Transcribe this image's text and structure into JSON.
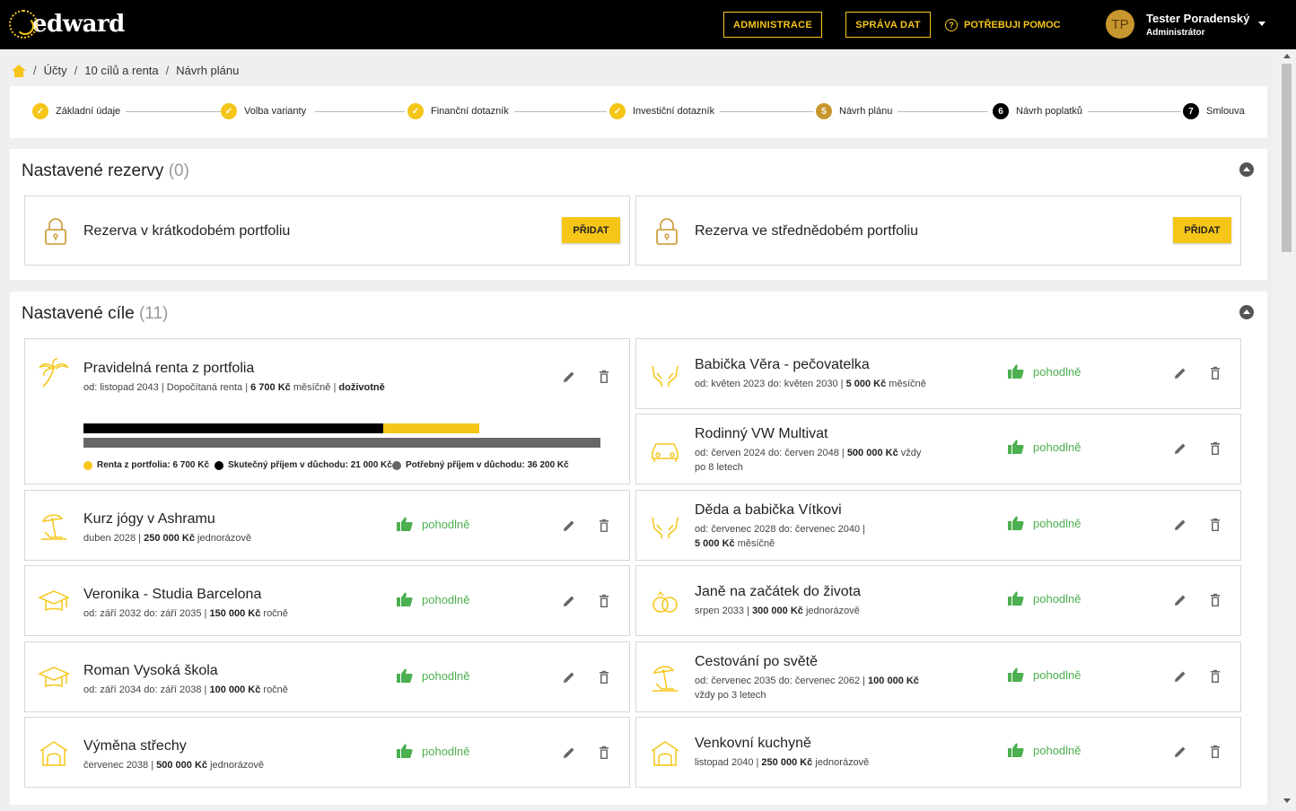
{
  "header": {
    "logo_text": "edward",
    "admin_label": "ADMINISTRACE",
    "data_label": "SPRÁVA DAT",
    "help_label": "POTŘEBUJI POMOC",
    "avatar_initials": "TP",
    "user_name": "Tester Poradenský",
    "user_role": "Administrátor"
  },
  "breadcrumb": [
    "Účty",
    "10 cílů a renta",
    "Návrh plánu"
  ],
  "steps": [
    {
      "label": "Základní údaje",
      "state": "done",
      "marker": ""
    },
    {
      "label": "Volba varianty",
      "state": "done",
      "marker": ""
    },
    {
      "label": "Finanční dotazník",
      "state": "done",
      "marker": ""
    },
    {
      "label": "Investiční dotazník",
      "state": "done",
      "marker": ""
    },
    {
      "label": "Návrh plánu",
      "state": "current",
      "marker": "5"
    },
    {
      "label": "Návrh poplatků",
      "state": "todo",
      "marker": "6"
    },
    {
      "label": "Smlouva",
      "state": "todo",
      "marker": "7"
    }
  ],
  "reserves": {
    "title": "Nastavené rezervy",
    "count": "(0)",
    "items": [
      {
        "title": "Rezerva v krátkodobém portfoliu",
        "button": "PŘIDAT"
      },
      {
        "title": "Rezerva ve střednědobém portfoliu",
        "button": "PŘIDAT"
      }
    ]
  },
  "goals": {
    "title": "Nastavené cíle",
    "count": "(11)",
    "rent": {
      "title": "Pravidelná renta z portfolia",
      "sub_plain": "od: listopad 2043 | Dopočítaná renta | ",
      "sub_bold": "6 700 Kč",
      "sub_plain2": " měsíčně | ",
      "sub_bold2": "doživotně",
      "bar_actual_fraction": 0.58,
      "bar_rent_fraction": 0.185,
      "legend": [
        {
          "label": "Renta z portfolia: 6 700 Kč",
          "color": "#f5c518"
        },
        {
          "label": "Skutečný příjem v důchodu: 21 000 Kč",
          "color": "#000000"
        },
        {
          "label": "Potřebný příjem v důchodu: 36 200 Kč",
          "color": "#666666"
        }
      ]
    },
    "status_label": "pohodlně",
    "left": [
      {
        "title": "Kurz jógy v Ashramu",
        "l1": "duben 2028 | ",
        "b1": "250 000 Kč",
        "l2": " jednorázově",
        "icon": "beach-icon"
      },
      {
        "title": "Veronika - Studia Barcelona",
        "l1": "od: září 2032 do: září 2035 | ",
        "b1": "150 000 Kč",
        "l2": " ročně",
        "icon": "graduation-cap-icon"
      },
      {
        "title": "Roman Vysoká škola",
        "l1": "od: září 2034 do: září 2038 | ",
        "b1": "100 000 Kč",
        "l2": " ročně",
        "icon": "graduation-cap-icon"
      },
      {
        "title": "Výměna střechy",
        "l1": "červenec 2038 | ",
        "b1": "500 000 Kč",
        "l2": " jednorázově",
        "icon": "house-icon"
      }
    ],
    "right": [
      {
        "title": "Babička Věra - pečovatelka",
        "l1": "od: květen 2023 do: květen 2030 | ",
        "b1": "5 000 Kč",
        "l2": " měsíčně",
        "line2": "",
        "icon": "care-hands-icon"
      },
      {
        "title": "Rodinný VW Multivat",
        "l1": "od: červen 2024 do: červen 2048 | ",
        "b1": "500 000 Kč",
        "l2": "  vždy",
        "line2": "po 8 letech",
        "icon": "car-icon"
      },
      {
        "title": "Děda a babička Vítkovi",
        "l1": "od: červenec 2028 do: červenec 2040 |",
        "b1": "",
        "l2": "",
        "line2b": "5 000 Kč",
        "line2": " měsíčně",
        "icon": "care-hands-icon"
      },
      {
        "title": "Janě na začátek do života",
        "l1": "srpen 2033 | ",
        "b1": "300 000 Kč",
        "l2": " jednorázově",
        "line2": "",
        "icon": "rings-icon"
      },
      {
        "title": "Cestování po světě",
        "l1": "od: červenec 2035 do: červenec 2062 | ",
        "b1": "100 000 Kč",
        "l2": "",
        "line2": "vždy po 3 letech",
        "icon": "beach-icon"
      },
      {
        "title": "Venkovní kuchyně",
        "l1": "listopad 2040 | ",
        "b1": "250 000 Kč",
        "l2": " jednorázově",
        "line2": "",
        "icon": "house-icon"
      }
    ]
  },
  "colors": {
    "accent": "#f5c518",
    "accent_dark": "#c8962e",
    "status_green": "#4caf50"
  }
}
